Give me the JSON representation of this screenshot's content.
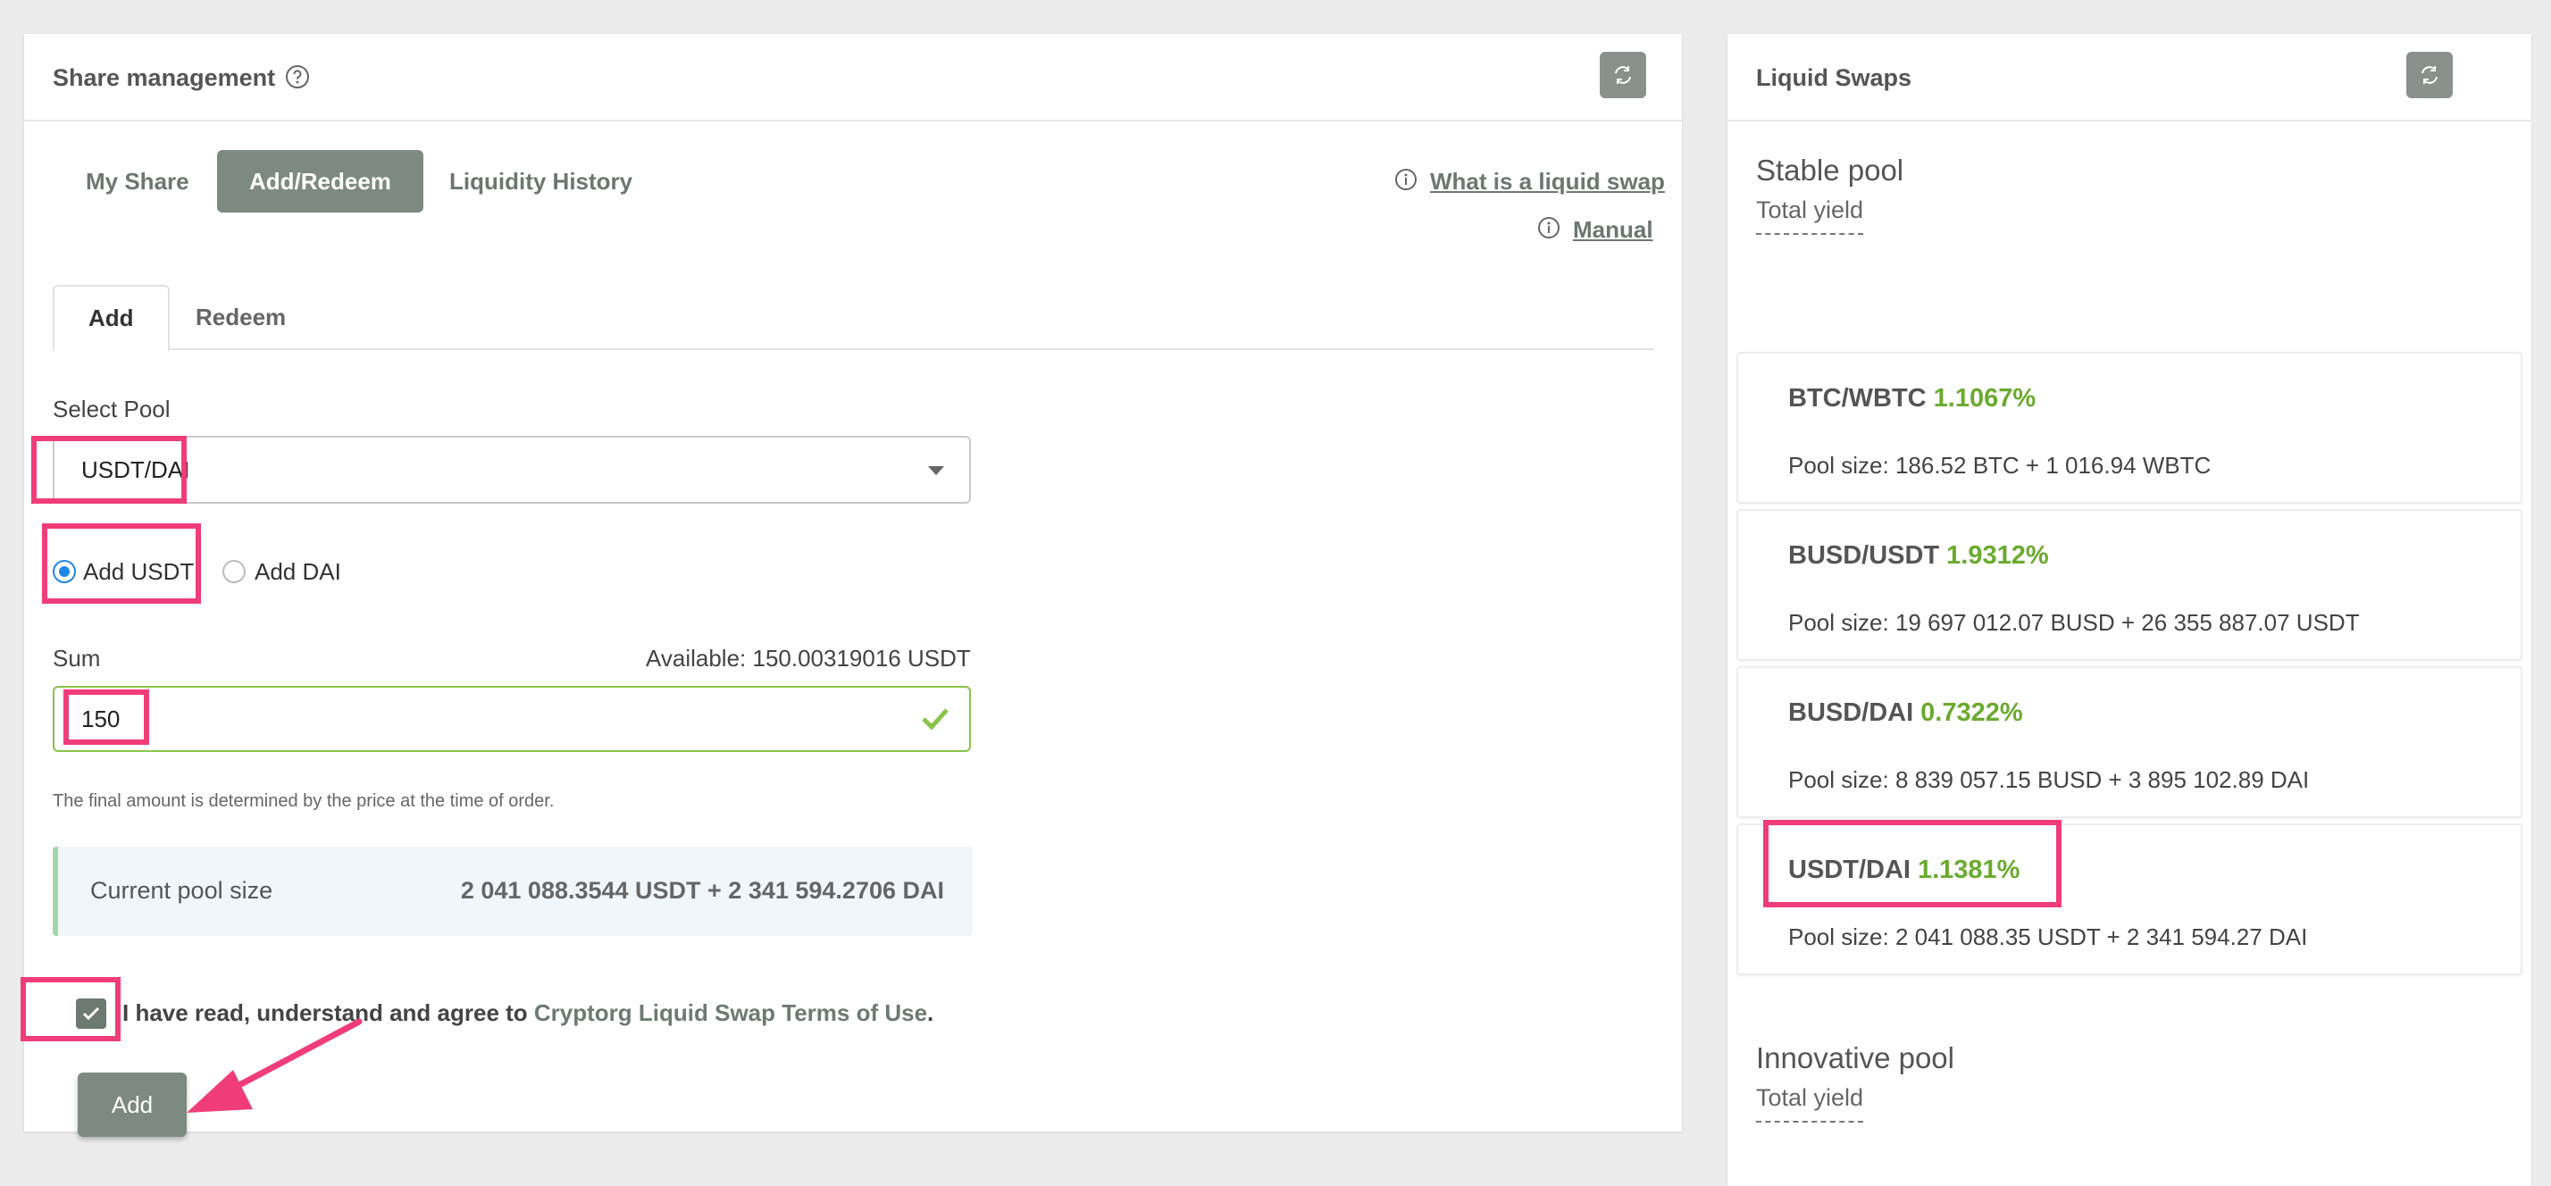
{
  "left_panel": {
    "title": "Share management",
    "tabs": [
      {
        "label": "My Share"
      },
      {
        "label": "Add/Redeem"
      },
      {
        "label": "Liquidity History"
      }
    ],
    "links": {
      "what_is": "What is a liquid swap",
      "manual": "Manual"
    },
    "subtabs": [
      {
        "label": "Add"
      },
      {
        "label": "Redeem"
      }
    ],
    "select_pool": {
      "label": "Select Pool",
      "value": "USDT/DAI"
    },
    "radios": [
      {
        "label": "Add USDT",
        "checked": true
      },
      {
        "label": "Add DAI",
        "checked": false
      }
    ],
    "sum": {
      "label": "Sum",
      "available": "Available: 150.00319016 USDT",
      "value": "150",
      "hint": "The final amount is determined by the price at the time of order."
    },
    "current_pool": {
      "label": "Current pool size",
      "value": "2 041 088.3544 USDT + 2 341 594.2706 DAI"
    },
    "agree": {
      "text": "I have read, understand and agree to ",
      "link": "Cryptorg Liquid Swap Terms of Use",
      "suffix": "."
    },
    "add_button": "Add"
  },
  "right_panel": {
    "title": "Liquid Swaps",
    "stable": {
      "title": "Stable pool",
      "subtitle": "Total yield"
    },
    "pools": [
      {
        "name": "BTC/WBTC",
        "rate": "1.1067%",
        "size": "Pool size: 186.52 BTC + 1 016.94 WBTC"
      },
      {
        "name": "BUSD/USDT",
        "rate": "1.9312%",
        "size": "Pool size: 19 697 012.07 BUSD + 26 355 887.07 USDT"
      },
      {
        "name": "BUSD/DAI",
        "rate": "0.7322%",
        "size": "Pool size: 8 839 057.15 BUSD + 3 895 102.89 DAI"
      },
      {
        "name": "USDT/DAI",
        "rate": "1.1381%",
        "size": "Pool size: 2 041 088.35 USDT + 2 341 594.27 DAI"
      }
    ],
    "innovative": {
      "title": "Innovative pool",
      "subtitle": "Total yield"
    }
  },
  "colors": {
    "accent": "#7c8a81",
    "highlight": "#f03d7a",
    "rate_green": "#6aaa2f",
    "valid_green": "#8bc34a"
  }
}
